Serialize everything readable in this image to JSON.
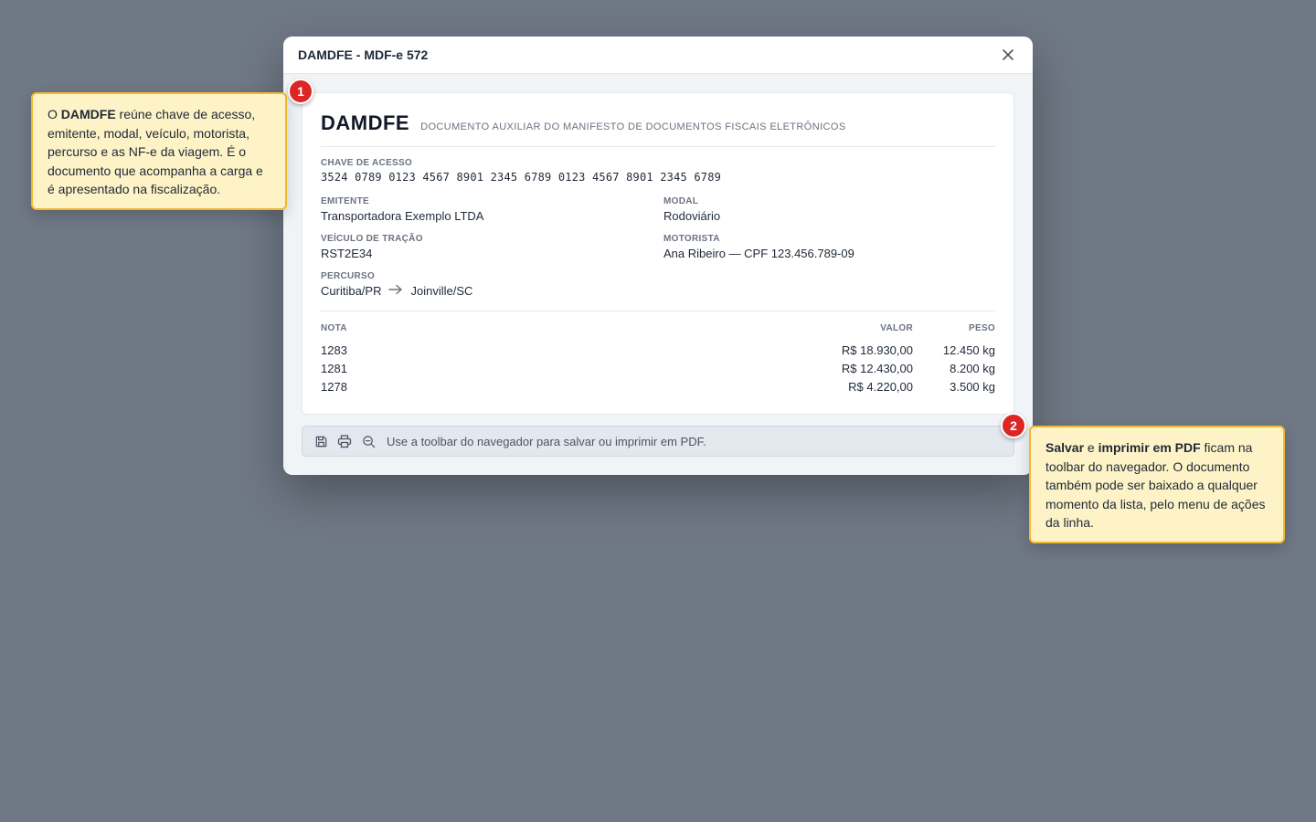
{
  "modal": {
    "title": "DAMDFE - MDF-e 572",
    "close_icon": "close-icon"
  },
  "document": {
    "title": "DAMDFE",
    "subtitle": "DOCUMENTO AUXILIAR DO MANIFESTO DE DOCUMENTOS FISCAIS ELETRÔNICOS",
    "chave": {
      "label": "CHAVE DE ACESSO",
      "value": "3524 0789 0123 4567 8901 2345 6789 0123 4567 8901 2345 6789"
    },
    "emitente": {
      "label": "EMITENTE",
      "value": "Transportadora Exemplo LTDA"
    },
    "modal": {
      "label": "MODAL",
      "value": "Rodoviário"
    },
    "veiculo": {
      "label": "VEÍCULO DE TRAÇÃO",
      "value": "RST2E34"
    },
    "motorista": {
      "label": "MOTORISTA",
      "value": "Ana Ribeiro — CPF 123.456.789-09"
    },
    "percurso": {
      "label": "PERCURSO",
      "origem": "Curitiba/PR",
      "destino": "Joinville/SC",
      "arrow_icon": "arrow-right-icon"
    },
    "notas": {
      "headers": {
        "nota": "NOTA",
        "valor": "VALOR",
        "peso": "PESO"
      },
      "rows": [
        {
          "nota": "1283",
          "valor": "R$ 18.930,00",
          "peso": "12.450 kg"
        },
        {
          "nota": "1281",
          "valor": "R$ 12.430,00",
          "peso": "8.200 kg"
        },
        {
          "nota": "1278",
          "valor": "R$ 4.220,00",
          "peso": "3.500 kg"
        }
      ]
    }
  },
  "toolbar": {
    "icons": [
      "save-icon",
      "print-icon",
      "zoom-out-icon"
    ],
    "hint": "Use a toolbar do navegador para salvar ou imprimir em PDF."
  },
  "callouts": [
    {
      "number": "1",
      "parts": [
        {
          "t": "O ",
          "b": false
        },
        {
          "t": "DAMDFE",
          "b": true
        },
        {
          "t": " reúne chave de acesso, emitente, modal, veículo, motorista, percurso e as NF-e da viagem. É o documento que acompanha a carga e é apresentado na fiscalização.",
          "b": false
        }
      ]
    },
    {
      "number": "2",
      "parts": [
        {
          "t": "Salvar",
          "b": true
        },
        {
          "t": " e ",
          "b": false
        },
        {
          "t": "imprimir em PDF",
          "b": true
        },
        {
          "t": " ficam na toolbar do navegador. O documento também pode ser baixado a qualquer momento da lista, pelo menu de ações da linha.",
          "b": false
        }
      ]
    }
  ],
  "colors": {
    "backdrop": "#6f7885",
    "callout_bg": "#fef3c7",
    "callout_border": "#f5b731",
    "badge": "#dc2626"
  }
}
